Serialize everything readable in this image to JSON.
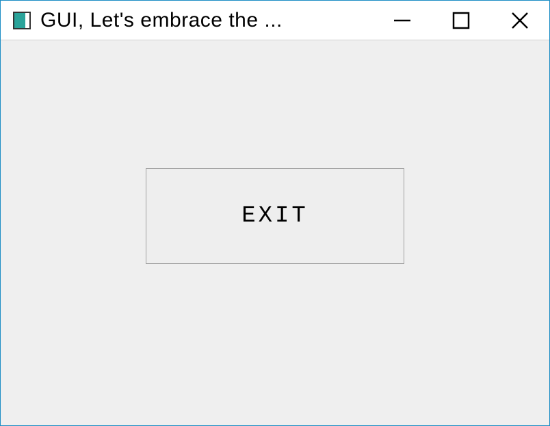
{
  "window": {
    "title": "GUI, Let's embrace the ..."
  },
  "main": {
    "exit_button_label": "EXIT"
  }
}
